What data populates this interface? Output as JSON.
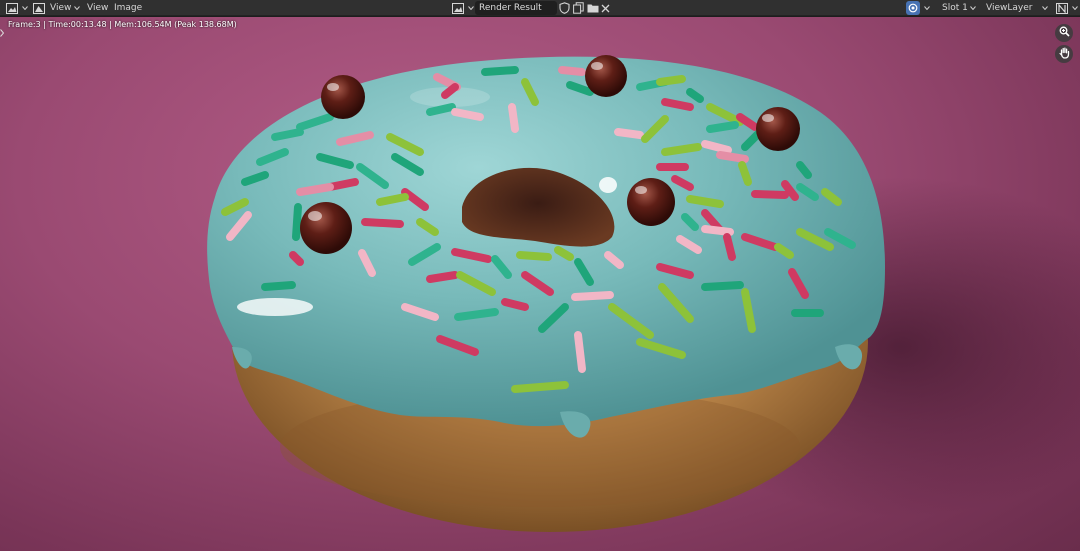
{
  "header": {
    "menus": {
      "view1": "View",
      "view2": "View",
      "image": "Image"
    },
    "image_name": "Render Result",
    "slot": "Slot 1",
    "view_layer": "ViewLayer"
  },
  "viewport": {
    "render_stats": "Frame:3 | Time:00:13.48 | Mem:106.54M (Peak 138.68M)"
  },
  "colors": {
    "header_bg": "#303030",
    "background_pink": "#9a4a72",
    "icing": "#7fc0c0",
    "dough": "#c89a5a",
    "render_engine_accent": "#4772b3"
  },
  "icons": [
    "image-editor-icon",
    "view-mode-icon",
    "image-browse-icon",
    "fake-user-shield-icon",
    "duplicate-icon",
    "folder-icon",
    "close-icon",
    "render-engine-icon",
    "display-options-icon",
    "zoom-icon",
    "hand-pan-icon"
  ]
}
